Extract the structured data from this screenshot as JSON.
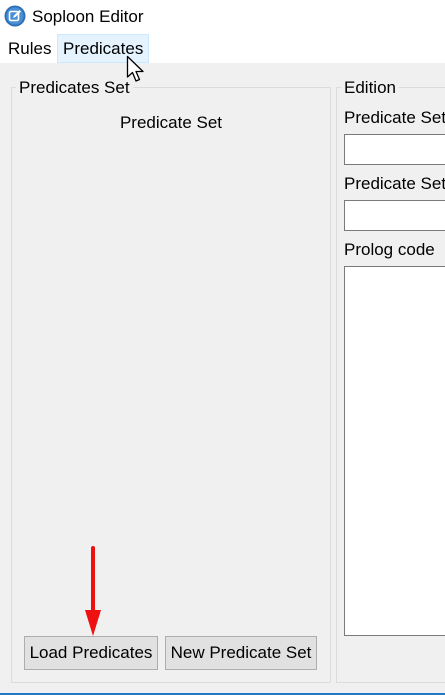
{
  "window": {
    "title": "Soploon Editor",
    "icon": "edit-icon"
  },
  "menubar": {
    "items": [
      {
        "label": "Rules"
      },
      {
        "label": "Predicates",
        "hovered": true
      }
    ]
  },
  "left_panel": {
    "group_title": "Predicates Set",
    "list_header": "Predicate Set",
    "buttons": {
      "load_label": "Load Predicates",
      "new_label": "New Predicate Set"
    }
  },
  "right_panel": {
    "group_title": "Edition",
    "fields": [
      {
        "label": "Predicate Set",
        "value": ""
      },
      {
        "label": "Predicate Set",
        "value": ""
      }
    ],
    "prolog": {
      "label": "Prolog code",
      "value": ""
    }
  },
  "colors": {
    "titlebar_bg": "#ffffff",
    "window_bg": "#f0f0f0",
    "menu_hover_bg": "#e5f3ff",
    "annotation_arrow": "#ee1111",
    "accent_border": "#1e78c8"
  }
}
